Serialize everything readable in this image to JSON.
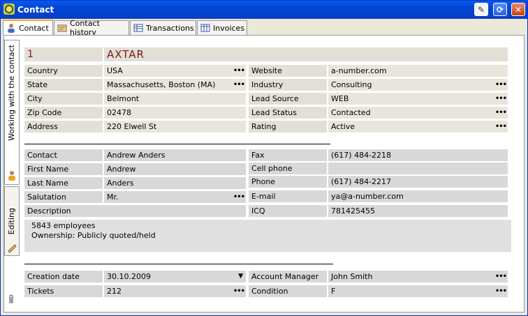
{
  "window": {
    "title": "Contact",
    "buttons": {
      "pin": "✎",
      "refresh": "⟳",
      "close": "✕"
    }
  },
  "tabs": [
    {
      "label": "Contact",
      "icon": "person-icon",
      "active": true
    },
    {
      "label": "Contact history",
      "icon": "history-icon",
      "active": false
    },
    {
      "label": "Transactions",
      "icon": "table-icon",
      "active": false
    },
    {
      "label": "Invoices",
      "icon": "invoice-icon",
      "active": false
    }
  ],
  "side_tabs": [
    {
      "label": "Working with the contact",
      "icon": "person-icon"
    },
    {
      "label": "Editing",
      "icon": "pencil-icon"
    },
    {
      "label": "",
      "icon": "paperclip-icon"
    }
  ],
  "record": {
    "id": "1",
    "name": "AXTAR"
  },
  "fields": {
    "country": {
      "label": "Country",
      "value": "USA"
    },
    "state": {
      "label": "State",
      "value": "Massachusetts, Boston (MA)"
    },
    "city": {
      "label": "City",
      "value": "Belmont"
    },
    "zip": {
      "label": "Zip Code",
      "value": "02478"
    },
    "address": {
      "label": "Address",
      "value": "220 Elwell St"
    },
    "website": {
      "label": "Website",
      "value": "a-number.com"
    },
    "industry": {
      "label": "Industry",
      "value": "Consulting"
    },
    "lead_source": {
      "label": "Lead Source",
      "value": "WEB"
    },
    "lead_status": {
      "label": "Lead Status",
      "value": "Contacted"
    },
    "rating": {
      "label": "Rating",
      "value": "Active"
    },
    "contact": {
      "label": "Contact",
      "value": "Andrew Anders"
    },
    "first_name": {
      "label": "First Name",
      "value": "Andrew"
    },
    "last_name": {
      "label": "Last Name",
      "value": "Anders"
    },
    "salutation": {
      "label": "Salutation",
      "value": "Mr."
    },
    "description": {
      "label": "Description",
      "lines": [
        "5843 employees",
        "Ownership: Publicly quoted/held"
      ]
    },
    "fax": {
      "label": "Fax",
      "value": "(617) 484-2218"
    },
    "cell_phone": {
      "label": "Cell phone",
      "value": ""
    },
    "phone": {
      "label": "Phone",
      "value": "(617) 484-2217"
    },
    "email": {
      "label": "E-mail",
      "value": "ya@a-number.com"
    },
    "icq": {
      "label": "ICQ",
      "value": "781425455"
    },
    "creation_date": {
      "label": "Creation date",
      "value": "30.10.2009"
    },
    "tickets": {
      "label": "Tickets",
      "value": "212"
    },
    "account_manager": {
      "label": "Account Manager",
      "value": "John Smith"
    },
    "condition": {
      "label": "Condition",
      "value": "F"
    }
  },
  "glyphs": {
    "ellipsis": "•••",
    "dropdown": "▼"
  },
  "colors": {
    "titlebar": "#0a5ae8",
    "accent_text": "#7a1b1b",
    "field_bg": "#e2e0d6"
  }
}
